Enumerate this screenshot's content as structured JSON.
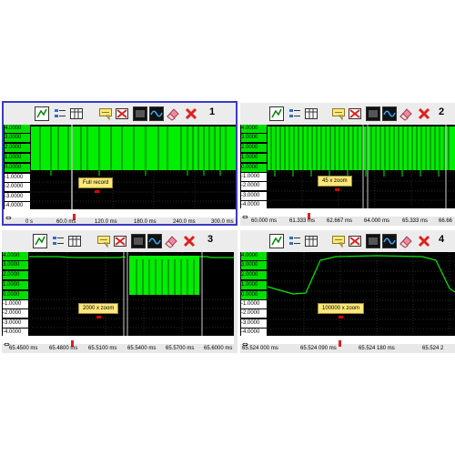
{
  "colors": {
    "trace": "#00ee00",
    "grid": "#555555",
    "panel_select": "#3a3ac8",
    "tag_bg": "#ffe87a"
  },
  "toolbar_icons": [
    "scope-icon",
    "channel-list-icon",
    "table-icon",
    "tooltip-icon",
    "disable-icon",
    "display-icon",
    "waveform-icon",
    "eraser-icon",
    "close-icon"
  ],
  "panels": [
    {
      "number": "1",
      "y_labels": [
        "4.0000",
        "3.0000",
        "2.0000",
        "1.0000",
        "0.0000",
        "-1.0000",
        "-2.0000",
        "-3.0000",
        "-4.0000"
      ],
      "x_labels": [
        "0 s",
        "60.0 ms",
        "120.0 ms",
        "180.0 ms",
        "240.0 ms",
        "300.0 ms"
      ],
      "tag": "Full record"
    },
    {
      "number": "2",
      "y_labels": [
        "4.0000",
        "3.0000",
        "2.0000",
        "1.0000",
        "0.0000",
        "-1.0000",
        "-2.0000",
        "-3.0000",
        "-4.0000"
      ],
      "x_labels": [
        "60.000 ms",
        "61.333 ms",
        "62.667 ms",
        "64.000 ms",
        "65.333 ms",
        "66.66"
      ],
      "tag": "45 x zoom"
    },
    {
      "number": "3",
      "y_labels": [
        "4.0000",
        "3.0000",
        "2.0000",
        "1.0000",
        "0.0000",
        "-1.0000",
        "-2.0000",
        "-3.0000",
        "-4.0000"
      ],
      "x_labels": [
        "65.4500 ms",
        "65.4800 ms",
        "65.5100 ms",
        "65.5400 ms",
        "65.5700 ms",
        "65.6000 ms"
      ],
      "tag": "2000 x zoom"
    },
    {
      "number": "4",
      "y_labels": [
        "4.0000",
        "3.0000",
        "2.0000",
        "1.0000",
        "0.0000",
        "-1.0000",
        "-2.0000",
        "-3.0000",
        "-4.0000"
      ],
      "x_labels": [
        "65.524 000 ms",
        "65.524 090 ms",
        "65.524 180 ms",
        "65.524 2"
      ],
      "tag": "100000 x zoom"
    }
  ]
}
